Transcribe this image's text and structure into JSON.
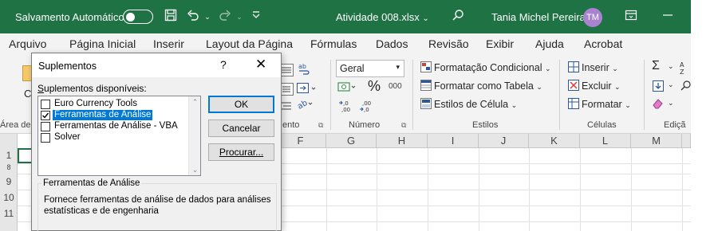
{
  "titlebar": {
    "autosave_label": "Salvamento Automático",
    "autosave_state": "",
    "filename": "Atividade 008.xlsx",
    "filename_caret": "⌄",
    "user_name": "Tania Michel Pereira",
    "user_initials": "TM",
    "icons": [
      "save-icon",
      "undo-icon",
      "redo-icon",
      "customize-icon",
      "search-icon",
      "ribbon-display-icon",
      "minimize-icon"
    ]
  },
  "tabs": [
    {
      "label": "Arquivo"
    },
    {
      "label": "Página Inicial",
      "active": true
    },
    {
      "label": "Inserir"
    },
    {
      "label": "Layout da Página"
    },
    {
      "label": "Fórmulas"
    },
    {
      "label": "Dados"
    },
    {
      "label": "Revisão"
    },
    {
      "label": "Exibir"
    },
    {
      "label": "Ajuda"
    },
    {
      "label": "Acrobat"
    }
  ],
  "ribbon": {
    "clipboard_group_label": "Área de",
    "clipboard_fragment": "C",
    "alignment_group_label": "ento",
    "number": {
      "format_value": "Geral",
      "percent_symbol": "%",
      "thousands": "000",
      "group_label": "Número"
    },
    "styles": {
      "conditional_formatting": "Formatação Condicional",
      "format_as_table": "Formatar como Tabela",
      "cell_styles": "Estilos de Célula",
      "group_label": "Estilos"
    },
    "cells": {
      "insert": "Inserir",
      "delete": "Excluir",
      "format": "Formatar",
      "group_label": "Células"
    },
    "editing_group_label": "Ediçã"
  },
  "grid": {
    "columns": [
      "F",
      "G",
      "H",
      "I",
      "J",
      "K",
      "L",
      "M"
    ],
    "rows": [
      "1",
      "8",
      "9",
      "10",
      "11"
    ]
  },
  "dialog": {
    "title": "Suplementos",
    "help": "?",
    "close": "✕",
    "list_label_prefix": "S",
    "list_label_rest": "uplementos disponíveis:",
    "addins": [
      {
        "label": "Euro Currency Tools",
        "checked": false,
        "selected": false
      },
      {
        "label": "Ferramentas de Análise",
        "checked": true,
        "selected": true
      },
      {
        "label": "Ferramentas de Análise - VBA",
        "checked": false,
        "selected": false
      },
      {
        "label": "Solver",
        "checked": false,
        "selected": false
      }
    ],
    "ok_label": "OK",
    "cancel_label": "Cancelar",
    "browse_label": "Procurar...",
    "desc_title": "Ferramentas de Análise",
    "desc_text": "Fornece ferramentas de análise de dados para análises estatísticas e de engenharia"
  },
  "colors": {
    "excel_green": "#1f7244",
    "selection_blue": "#0078d7",
    "avatar": "#a983d0"
  }
}
